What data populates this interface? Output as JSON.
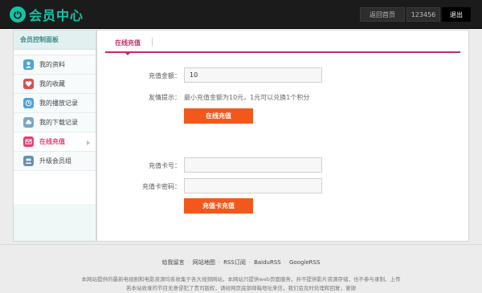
{
  "header": {
    "logo_text": "会员中心",
    "home_label": "返回首页",
    "username": "123456",
    "logout_label": "退出"
  },
  "sidebar": {
    "title": "会员控制面板",
    "items": [
      {
        "label": "我的资料",
        "icon": "user-profile-icon",
        "color": "#4fa3d9"
      },
      {
        "label": "我的收藏",
        "icon": "heart-icon",
        "color": "#d94f4f"
      },
      {
        "label": "我的播放记录",
        "icon": "history-icon",
        "color": "#4fa3d9"
      },
      {
        "label": "我的下载记录",
        "icon": "cloud-download-icon",
        "color": "#7aa7c7"
      },
      {
        "label": "在线充值",
        "icon": "envelope-icon",
        "color": "#e63f6e"
      },
      {
        "label": "升级会员组",
        "icon": "group-icon",
        "color": "#6a8fb0"
      }
    ]
  },
  "tabs": [
    {
      "label": "在线充值"
    }
  ],
  "form_amount": {
    "amount_label": "充值金额：",
    "amount_value": "10",
    "tip_label": "友情提示：",
    "tip_text": "最小充值金额为10元，1元可以兑换1个积分",
    "submit_label": "在线充值"
  },
  "form_card": {
    "card_no_label": "充值卡号：",
    "card_no_value": "",
    "card_pwd_label": "充值卡密码：",
    "card_pwd_value": "",
    "submit_label": "充值卡充值"
  },
  "footer": {
    "links": [
      "给我留言",
      "网站地图",
      "RSS订阅",
      "BaiduRSS",
      "GoogleRSS"
    ],
    "line1": "本网站提供的最新电视剧和电影资源均系收集于各大视频网站，本网站只提供web页面服务，并不提供影片资源存储，也不参与录制、上传",
    "line2": "若本站收录的节目无意侵犯了贵司版权，请给网页底部邮箱地址来信，我们会及时处理和回复，谢谢"
  },
  "colors": {
    "accent": "#c62a6b",
    "button": "#f2581c",
    "brand": "#15c2a6"
  }
}
